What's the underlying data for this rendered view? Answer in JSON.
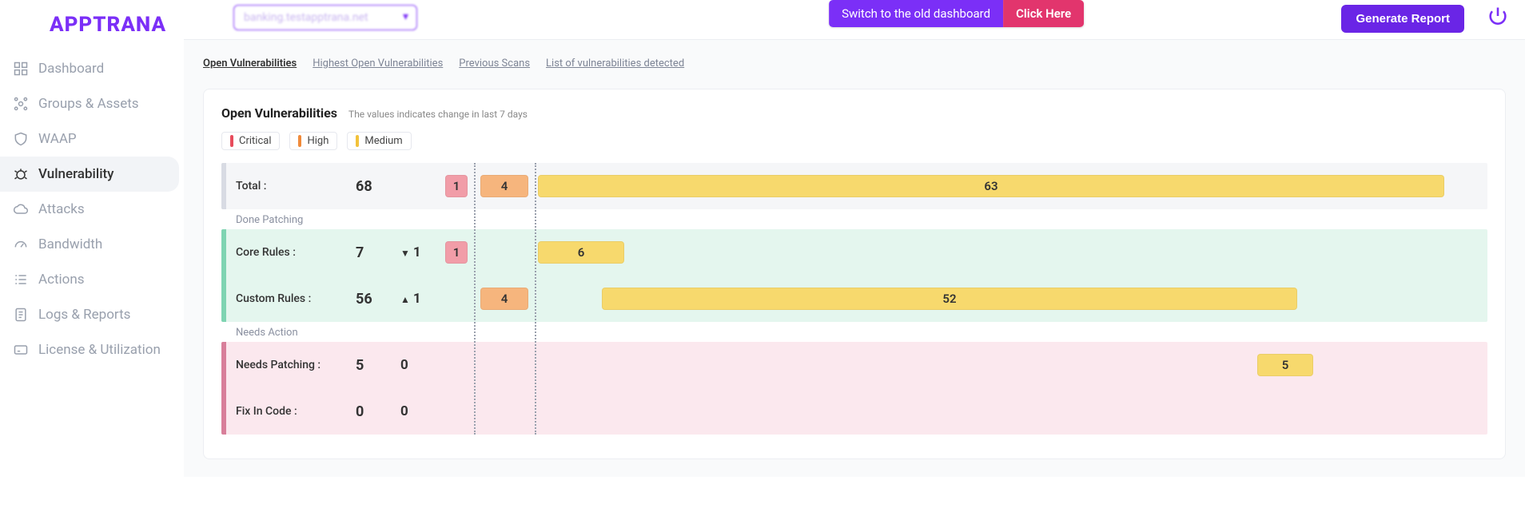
{
  "brand": "APPTRANA",
  "topbar": {
    "domain_selected": "banking.testapptrana.net",
    "switch_left": "Switch to the old dashboard",
    "switch_right": "Click Here",
    "generate_report": "Generate Report"
  },
  "sidebar": {
    "items": [
      {
        "label": "Dashboard"
      },
      {
        "label": "Groups & Assets"
      },
      {
        "label": "WAAP"
      },
      {
        "label": "Vulnerability"
      },
      {
        "label": "Attacks"
      },
      {
        "label": "Bandwidth"
      },
      {
        "label": "Actions"
      },
      {
        "label": "Logs & Reports"
      },
      {
        "label": "License & Utilization"
      }
    ],
    "active_index": 3
  },
  "anchors": {
    "items": [
      {
        "label": "Open Vulnerabilities"
      },
      {
        "label": "Highest Open Vulnerabilities"
      },
      {
        "label": "Previous Scans"
      },
      {
        "label": "List of vulnerabilities detected"
      }
    ],
    "active_index": 0
  },
  "card": {
    "title": "Open Vulnerabilities",
    "subtitle": "The values indicates change in last 7 days",
    "legend": {
      "critical": "Critical",
      "high": "High",
      "medium": "Medium"
    }
  },
  "chart_data": {
    "type": "bar",
    "series_labels": [
      "Critical",
      "High",
      "Medium"
    ],
    "rows": [
      {
        "group": "Total",
        "label": "Total :",
        "total": 68,
        "change": null,
        "critical": 1,
        "high": 4,
        "medium": 63
      },
      {
        "group": "Done Patching",
        "label": "Core Rules :",
        "total": 7,
        "change": -1,
        "critical": 1,
        "high": 0,
        "medium": 6
      },
      {
        "group": "Done Patching",
        "label": "Custom Rules :",
        "total": 56,
        "change": 1,
        "critical": 0,
        "high": 4,
        "medium": 52
      },
      {
        "group": "Needs Action",
        "label": "Needs Patching :",
        "total": 5,
        "change": 0,
        "critical": 0,
        "high": 0,
        "medium": 5
      },
      {
        "group": "Needs Action",
        "label": "Fix In Code :",
        "total": 0,
        "change": 0,
        "critical": 0,
        "high": 0,
        "medium": 0
      }
    ],
    "group_headers": {
      "done": "Done Patching",
      "needs": "Needs Action"
    },
    "colors": {
      "critical": "#f19da8",
      "high": "#f6b57d",
      "medium": "#f7d96d"
    }
  }
}
